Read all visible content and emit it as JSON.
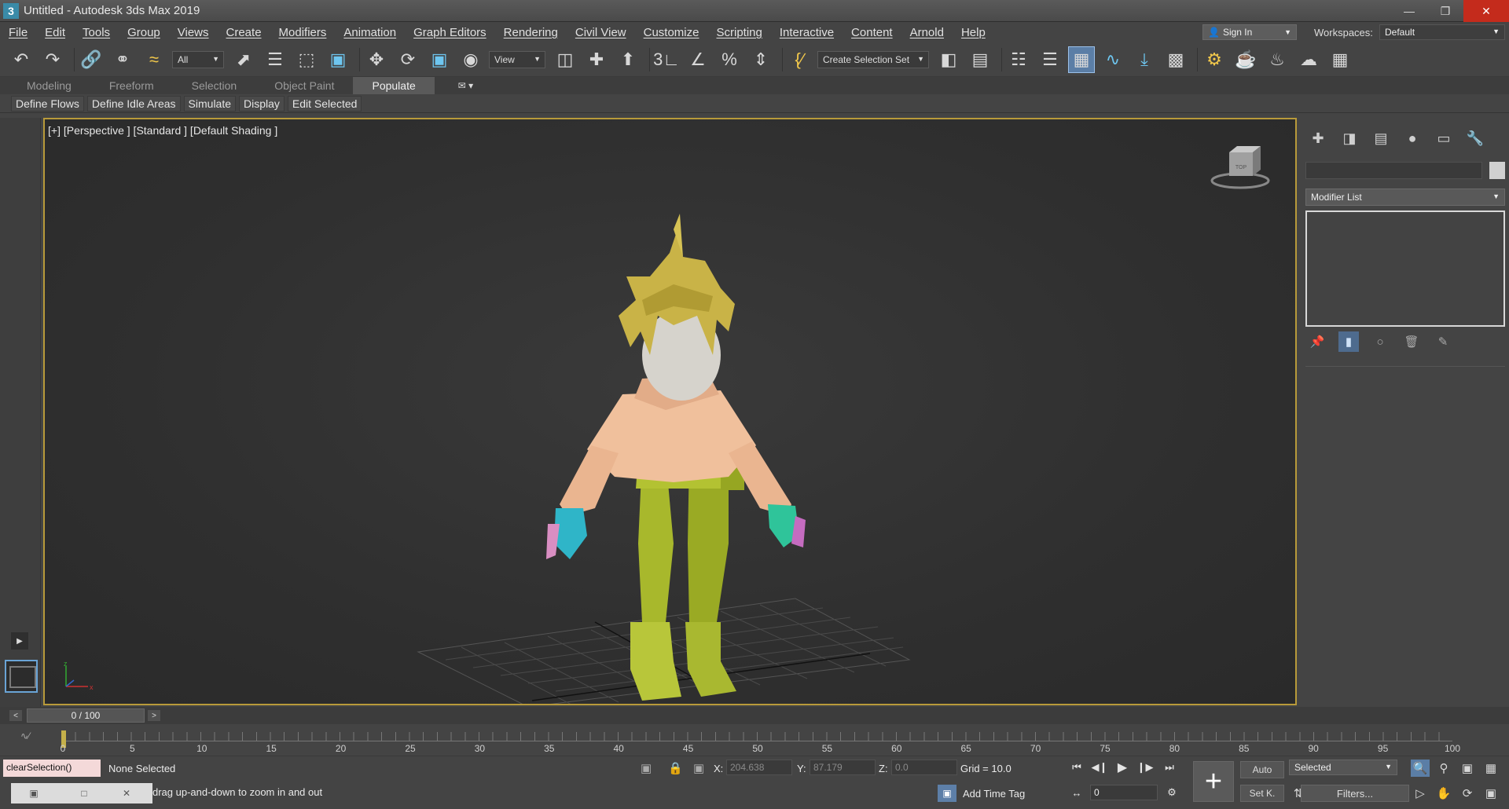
{
  "window": {
    "title": "Untitled - Autodesk 3ds Max 2019",
    "app_logo": "3",
    "controls": [
      "minimize-icon",
      "restore-icon",
      "close-icon"
    ]
  },
  "menu": {
    "items": [
      "File",
      "Edit",
      "Tools",
      "Group",
      "Views",
      "Create",
      "Modifiers",
      "Animation",
      "Graph Editors",
      "Rendering",
      "Civil View",
      "Customize",
      "Scripting",
      "Interactive",
      "Content",
      "Arnold",
      "Help"
    ],
    "sign_in": "Sign In",
    "workspaces_label": "Workspaces:",
    "workspaces_value": "Default"
  },
  "toolbar": {
    "filter_value": "All",
    "ref_coord_value": "View",
    "selection_set_value": "Create Selection Set"
  },
  "ribbon": {
    "tabs": [
      "Modeling",
      "Freeform",
      "Selection",
      "Object Paint",
      "Populate"
    ],
    "active_tab": "Populate",
    "sub_buttons": [
      "Define Flows",
      "Define Idle Areas",
      "Simulate",
      "Display",
      "Edit Selected"
    ]
  },
  "viewport": {
    "label": "[+] [Perspective ] [Standard ] [Default Shading ]",
    "viewcube_label": "TOP",
    "border_color": "#b89a3a"
  },
  "command_panel": {
    "modifier_list": "Modifier List"
  },
  "timeline": {
    "frame_display": "0 / 100",
    "prev": "<",
    "next": ">",
    "ticks": [
      "0",
      "5",
      "10",
      "15",
      "20",
      "25",
      "30",
      "35",
      "40",
      "45",
      "50",
      "55",
      "60",
      "65",
      "70",
      "75",
      "80",
      "85",
      "90",
      "95",
      "100"
    ]
  },
  "status": {
    "script_text": "clearSelection()",
    "selection_text": "None Selected",
    "prompt_text": "drag up-and-down to zoom in and out",
    "x_label": "X:",
    "x_value": "204.638",
    "y_label": "Y:",
    "y_value": "87.179",
    "z_label": "Z:",
    "z_value": "0.0",
    "grid_text": "Grid = 10.0",
    "add_time_tag": "Add Time Tag",
    "current_frame": "0",
    "auto_label": "Auto",
    "set_key_label": "Set K.",
    "selected_label": "Selected",
    "filters_label": "Filters..."
  }
}
